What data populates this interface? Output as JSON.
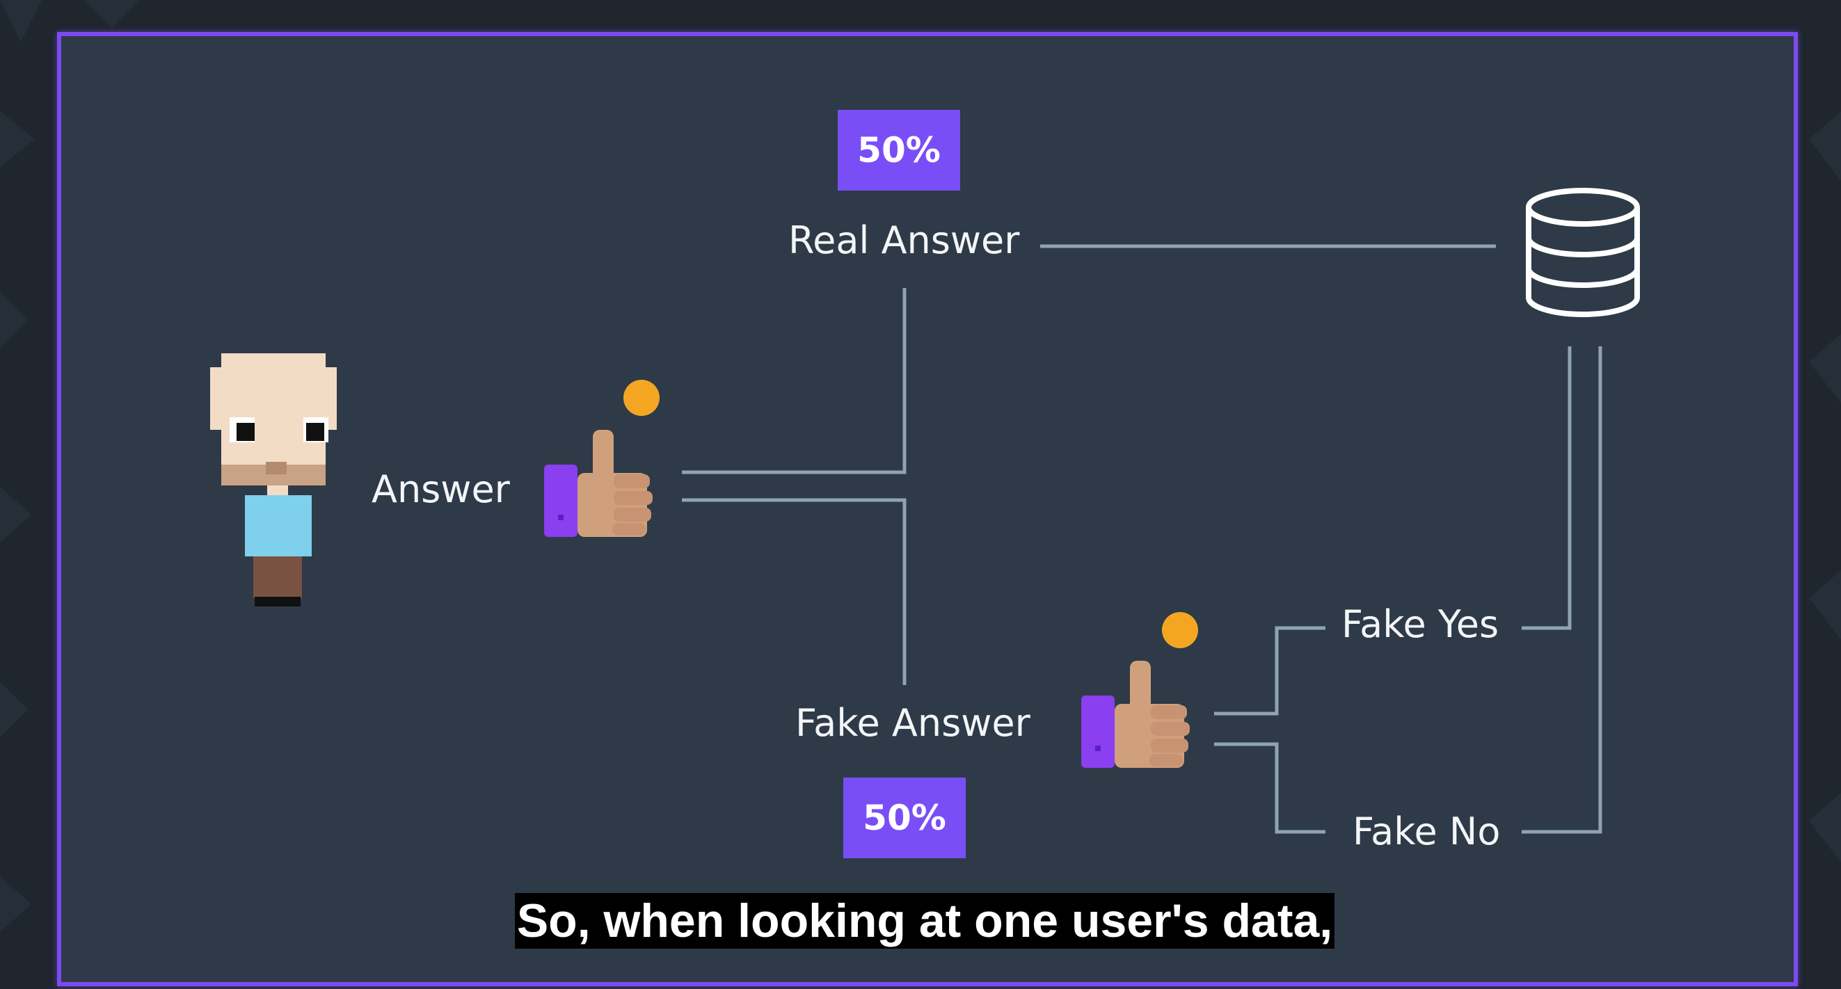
{
  "diagram": {
    "respondent_label": "Answer",
    "real_answer": {
      "label": "Real Answer",
      "probability": "50%"
    },
    "fake_answer": {
      "label": "Fake Answer",
      "probability": "50%"
    },
    "fake_yes": "Fake Yes",
    "fake_no": "Fake No"
  },
  "caption": "So, when looking at one user's data,",
  "colors": {
    "frame": "#7c4bf0",
    "panel": "#2e3a47",
    "line": "#8fa3b3",
    "badge": "#7a4ef6",
    "coin": "#f4a623"
  },
  "icons": [
    "pixel-person-icon",
    "thumbs-up-icon",
    "coin-icon",
    "database-icon"
  ]
}
